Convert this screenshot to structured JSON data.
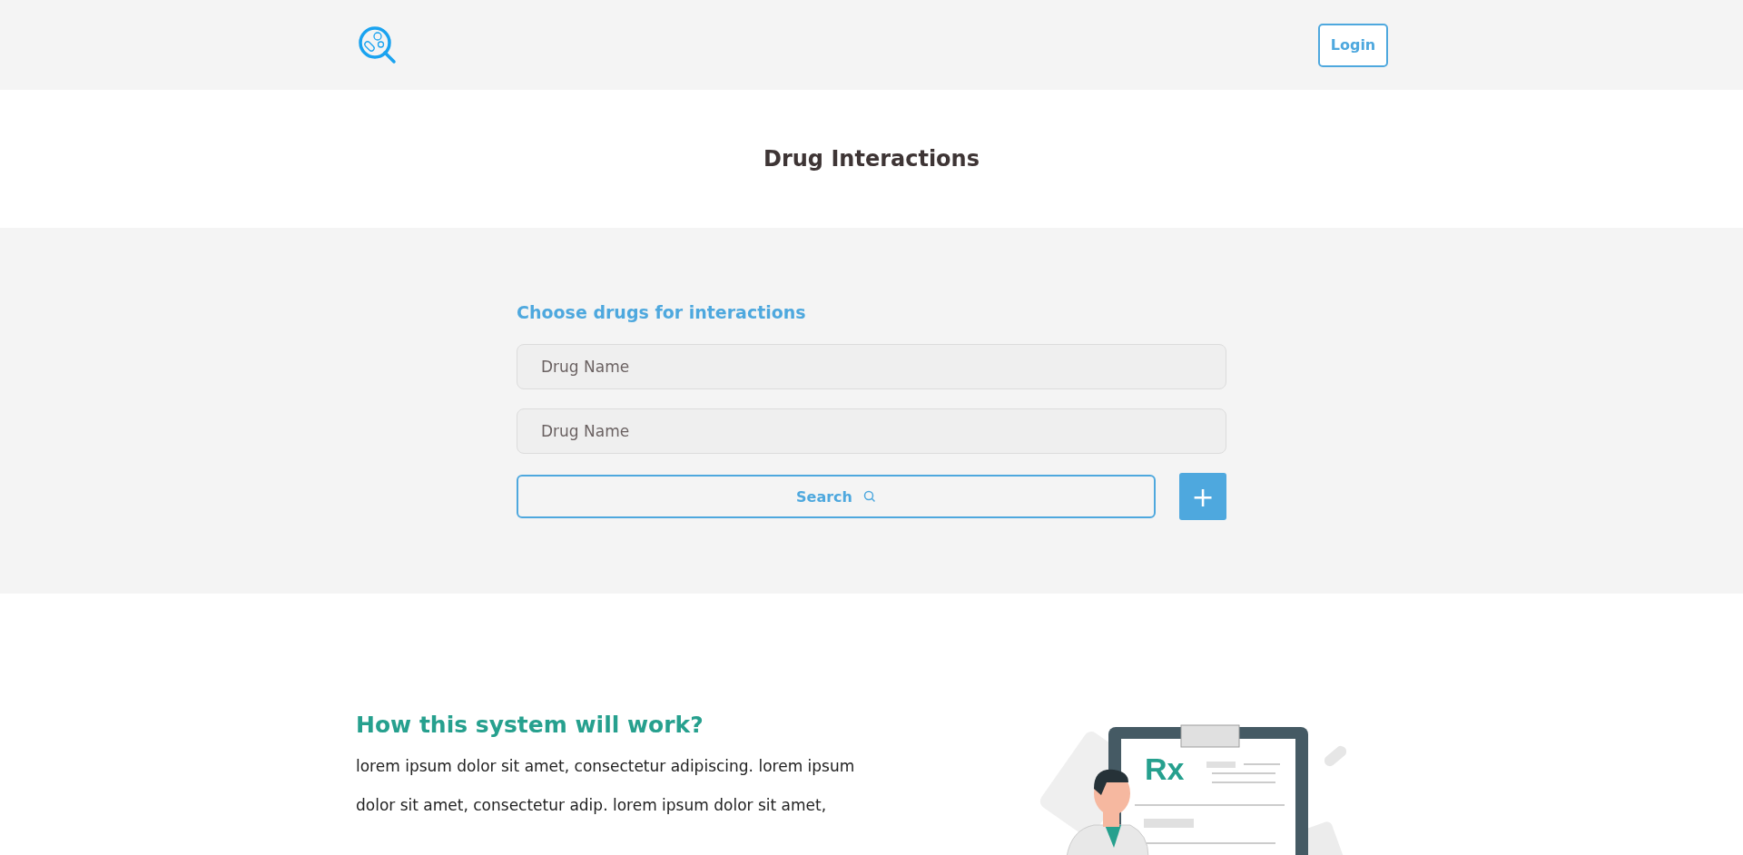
{
  "header": {
    "login_button": "Login"
  },
  "title": "Drug Interactions",
  "search_panel": {
    "label": "Choose drugs for interactions",
    "fields": [
      {
        "placeholder": "Drug Name"
      },
      {
        "placeholder": "Drug Name"
      }
    ],
    "search_button": "Search",
    "add_button": "+"
  },
  "info": {
    "heading": "How this system will work?",
    "text": "lorem ipsum dolor sit amet, consectetur adipiscing. lorem ipsum dolor sit amet, consectetur adip. lorem ipsum dolor sit amet,",
    "illustration_mark": "Rx"
  }
}
